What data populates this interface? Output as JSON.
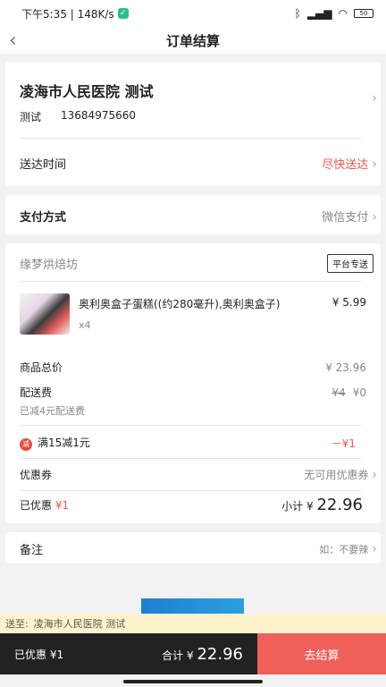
{
  "status_bar": {
    "time": "下午5:35 | 148K/s",
    "battery": "50"
  },
  "nav": {
    "title": "订单结算"
  },
  "address": {
    "name": "凌海市人民医院  测试",
    "contact": "测试",
    "phone": "13684975660"
  },
  "delivery": {
    "label": "送达时间",
    "value": "尽快送达"
  },
  "payment": {
    "label": "支付方式",
    "value": "微信支付"
  },
  "shop": {
    "name": "缘梦烘焙坊",
    "tag": "平台专送"
  },
  "product": {
    "name": "奥利奥盒子蛋糕((约280毫升),奥利奥盒子)",
    "price": "¥ 5.99",
    "qty": "x4"
  },
  "summary": {
    "goods_total_label": "商品总价",
    "goods_total": "¥ 23.96",
    "delivery_fee_label": "配送费",
    "delivery_fee_orig": "¥4",
    "delivery_fee": "¥0",
    "delivery_discount_note": "已减4元配送费",
    "promo_badge": "减",
    "promo_label": "满15减1元",
    "promo_value": "－¥1",
    "coupon_label": "优惠券",
    "coupon_value": "无可用优惠券",
    "saved_label": "已优惠",
    "saved_value": "¥1",
    "subtotal_label": "小计",
    "subtotal_currency": "¥",
    "subtotal_value": "22.96"
  },
  "remark": {
    "label": "备注",
    "placeholder": "如：不要辣"
  },
  "ship_to": {
    "label": "送至:",
    "address": "凌海市人民医院  测试"
  },
  "bottom": {
    "saved": "已优惠 ¥1",
    "total_label": "合计",
    "total_currency": "¥",
    "total_value": "22.96",
    "checkout": "去结算"
  },
  "colors": {
    "accent": "#e85b4c",
    "checkout_bg": "#f0605a",
    "bar_bg": "#222222"
  }
}
